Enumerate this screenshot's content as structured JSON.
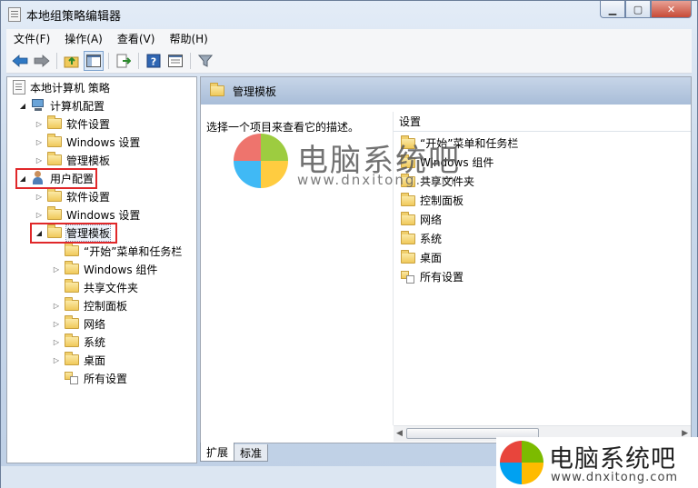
{
  "window": {
    "title": "本地组策略编辑器",
    "min": "▭",
    "max": "☐",
    "close": "✕"
  },
  "menu": [
    "文件(F)",
    "操作(A)",
    "查看(V)",
    "帮助(H)"
  ],
  "tree": {
    "root": "本地计算机 策略",
    "computer": "计算机配置",
    "computer_children": [
      "软件设置",
      "Windows 设置",
      "管理模板"
    ],
    "user": "用户配置",
    "user_children": [
      "软件设置",
      "Windows 设置"
    ],
    "admin_templates": "管理模板",
    "admin_children": [
      "“开始”菜单和任务栏",
      "Windows 组件",
      "共享文件夹",
      "控制面板",
      "网络",
      "系统",
      "桌面",
      "所有设置"
    ]
  },
  "right": {
    "header": "管理模板",
    "description": "选择一个项目来查看它的描述。",
    "column": "设置",
    "items": [
      "“开始”菜单和任务栏",
      "Windows 组件",
      "共享文件夹",
      "控制面板",
      "网络",
      "系统",
      "桌面",
      "所有设置"
    ]
  },
  "tabs": [
    "扩展",
    "标准"
  ],
  "watermark": {
    "text": "电脑系统吧",
    "url": "www.dnxitong.com"
  },
  "colors": {
    "highlight_box": "#e0282a",
    "logo_red": "#e8453c",
    "logo_green": "#7cbb00",
    "logo_blue": "#00a1f1",
    "logo_yellow": "#ffbb00"
  }
}
